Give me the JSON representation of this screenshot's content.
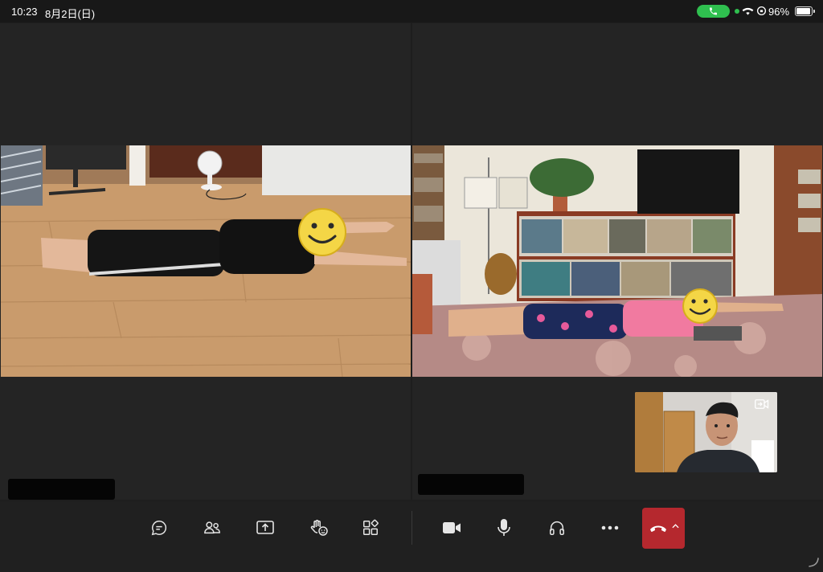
{
  "status_bar": {
    "time": "10:23",
    "date": "8月2日(日)",
    "battery_percent": "96%",
    "battery_level": 0.96
  },
  "participants": [
    {
      "tile": "left",
      "name": "",
      "scene": "child lying face down on wooden floor, arms outstretched"
    },
    {
      "tile": "right",
      "name": "",
      "scene": "woman lying face down on patterned rug in living room with bookshelves"
    }
  ],
  "self_view": {
    "camera_switch_icon": "camera-switch-icon"
  },
  "controls": [
    {
      "id": "chat",
      "icon": "chat-icon"
    },
    {
      "id": "people",
      "icon": "people-icon"
    },
    {
      "id": "share",
      "icon": "share-screen-icon"
    },
    {
      "id": "raise-hand",
      "icon": "raise-hand-react-icon"
    },
    {
      "id": "apps",
      "icon": "apps-icon"
    },
    {
      "id": "camera",
      "icon": "video-camera-icon"
    },
    {
      "id": "microphone",
      "icon": "microphone-icon"
    },
    {
      "id": "audio",
      "icon": "headphones-icon"
    },
    {
      "id": "more",
      "icon": "more-icon"
    },
    {
      "id": "leave",
      "icon": "hang-up-icon"
    }
  ],
  "colors": {
    "end_call": "#b5282e",
    "call_pill": "#2fbf4f",
    "tile_background": "#242424",
    "toolbar_background": "#202020"
  }
}
